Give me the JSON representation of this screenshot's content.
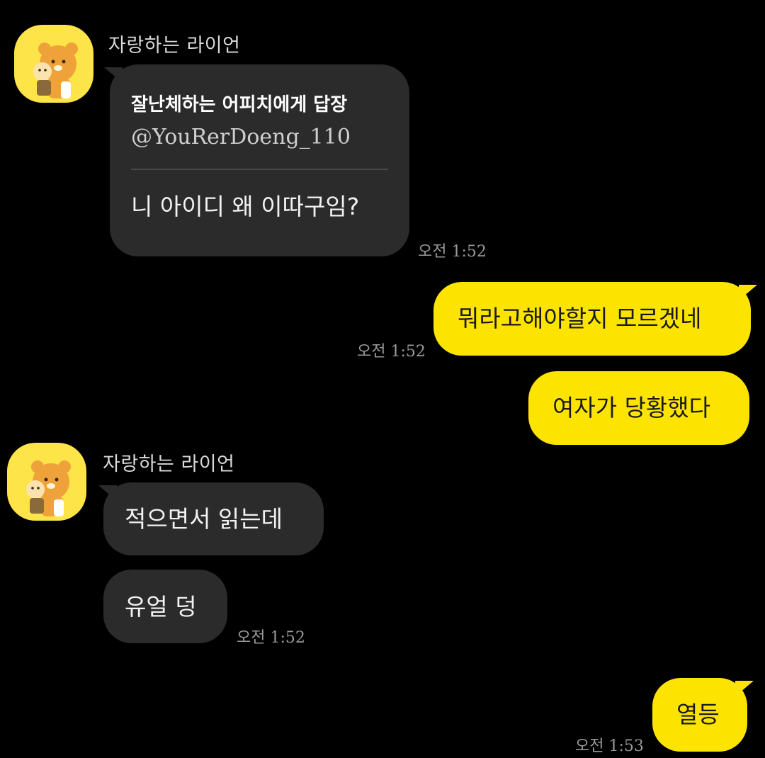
{
  "colors": {
    "background": "#000000",
    "incoming_bubble": "#2b2b2b",
    "outgoing_bubble": "#fde400",
    "avatar_background": "#fde449"
  },
  "icons": {
    "avatar": "ryan-character-avatar-icon"
  },
  "messages": {
    "group1": {
      "sender": "자랑하는 라이언",
      "reply_title": "잘난체하는 어피치에게 답장",
      "reply_handle": "@YouRerDoeng_110",
      "reply_body": "니 아이디 왜 이따구임?",
      "time": "오전 1:52"
    },
    "out1": {
      "text": "뭐라고해야할지 모르겠네",
      "time": "오전 1:52"
    },
    "out2": {
      "text": "여자가 당황했다"
    },
    "group2": {
      "sender": "자랑하는 라이언",
      "msg1": "적으면서 읽는데",
      "msg2": "유얼 덩",
      "time": "오전 1:52"
    },
    "out3": {
      "text": "열등",
      "time": "오전 1:53"
    }
  }
}
